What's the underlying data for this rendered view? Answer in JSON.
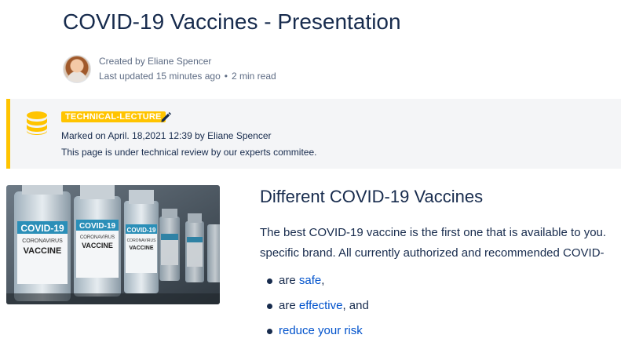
{
  "page": {
    "title": "COVID-19 Vaccines - Presentation",
    "created_by": "Created by Eliane Spencer",
    "last_updated": "Last updated 15 minutes ago",
    "dot": "•",
    "read_time": "2 min read"
  },
  "panel": {
    "icon": "database-icon",
    "accent_color": "#ffc400",
    "tag": "TECHNICAL-LECTURE",
    "marked": "Marked on April. 18,2021 12:39 by Eliane Spencer",
    "note": "This page is under technical review by our experts commitee."
  },
  "image": {
    "bottle_label_top": "COVID-19",
    "bottle_label_mid": "CORONAVIRUS",
    "bottle_label_bottom": "VACCINE"
  },
  "content": {
    "heading": "Different COVID-19 Vaccines",
    "para_line1": "The best COVID-19 vaccine is the first one that is available to you.",
    "para_line2": "specific brand. All currently authorized and recommended COVID-",
    "bullets": [
      {
        "prefix": "are ",
        "link": "safe",
        "suffix": ","
      },
      {
        "prefix": "are ",
        "link": "effective",
        "suffix": ", and"
      },
      {
        "prefix": "",
        "link": "reduce your risk",
        "suffix": ""
      }
    ],
    "link_color": "#0052cc"
  }
}
